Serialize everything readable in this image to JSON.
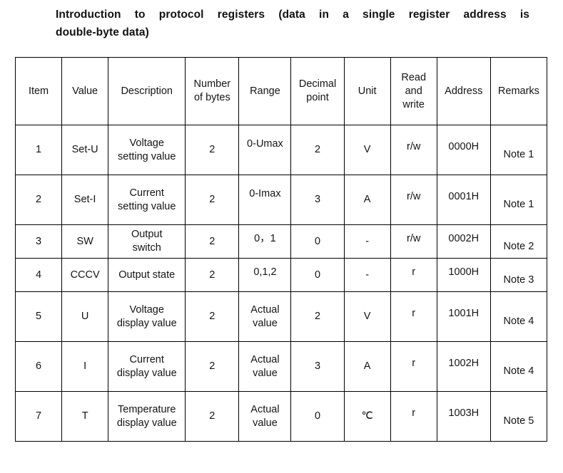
{
  "title": {
    "line_1": "Introduction to protocol registers (data in a single register address is",
    "line_2": "double-byte data)",
    "full": "Introduction to protocol registers (data in a single register address is double-byte data)"
  },
  "table": {
    "headers": [
      "Item",
      "Value",
      "Description",
      "Number of bytes",
      "Range",
      "Decimal point",
      "Unit",
      "Read and write",
      "Address",
      "Remarks"
    ],
    "header_lines": {
      "item": "Item",
      "value": "Value",
      "description": "Description",
      "bytes_1": "Number",
      "bytes_2": "of bytes",
      "range": "Range",
      "dec_1": "Decimal",
      "dec_2": "point",
      "unit": "Unit",
      "rw_1": "Read",
      "rw_2": "and",
      "rw_3": "write",
      "address": "Address",
      "remarks": "Remarks"
    },
    "rows": [
      {
        "item": "1",
        "value": "Set-U",
        "desc_1": "Voltage",
        "desc_2": "setting value",
        "bytes": "2",
        "range_1": "0-Umax",
        "range_2": "",
        "decimal": "2",
        "unit": "V",
        "rw": "r/w",
        "address": "0000H",
        "remarks": "Note 1"
      },
      {
        "item": "2",
        "value": "Set-I",
        "desc_1": "Current",
        "desc_2": "setting value",
        "bytes": "2",
        "range_1": "0-Imax",
        "range_2": "",
        "decimal": "3",
        "unit": "A",
        "rw": "r/w",
        "address": "0001H",
        "remarks": "Note 1"
      },
      {
        "item": "3",
        "value": "SW",
        "desc_1": "Output",
        "desc_2": "switch",
        "bytes": "2",
        "range_1": "0，1",
        "range_2": "",
        "decimal": "0",
        "unit": "-",
        "rw": "r/w",
        "address": "0002H",
        "remarks": "Note 2"
      },
      {
        "item": "4",
        "value": "CCCV",
        "desc_1": "Output state",
        "desc_2": "",
        "bytes": "2",
        "range_1": "0,1,2",
        "range_2": "",
        "decimal": "0",
        "unit": "-",
        "rw": "r",
        "address": "1000H",
        "remarks": "Note 3"
      },
      {
        "item": "5",
        "value": "U",
        "desc_1": "Voltage",
        "desc_2": "display value",
        "bytes": "2",
        "range_1": "Actual",
        "range_2": "value",
        "decimal": "2",
        "unit": "V",
        "rw": "r",
        "address": "1001H",
        "remarks": "Note 4"
      },
      {
        "item": "6",
        "value": "I",
        "desc_1": "Current",
        "desc_2": "display value",
        "bytes": "2",
        "range_1": "Actual",
        "range_2": "value",
        "decimal": "3",
        "unit": "A",
        "rw": "r",
        "address": "1002H",
        "remarks": "Note 4"
      },
      {
        "item": "7",
        "value": "T",
        "desc_1": "Temperature",
        "desc_2": "display value",
        "bytes": "2",
        "range_1": "Actual",
        "range_2": "value",
        "decimal": "0",
        "unit": "℃",
        "rw": "r",
        "address": "1003H",
        "remarks": "Note 5"
      }
    ]
  },
  "colors": {
    "border": "#000000",
    "text": "#141414",
    "background": "#ffffff"
  }
}
